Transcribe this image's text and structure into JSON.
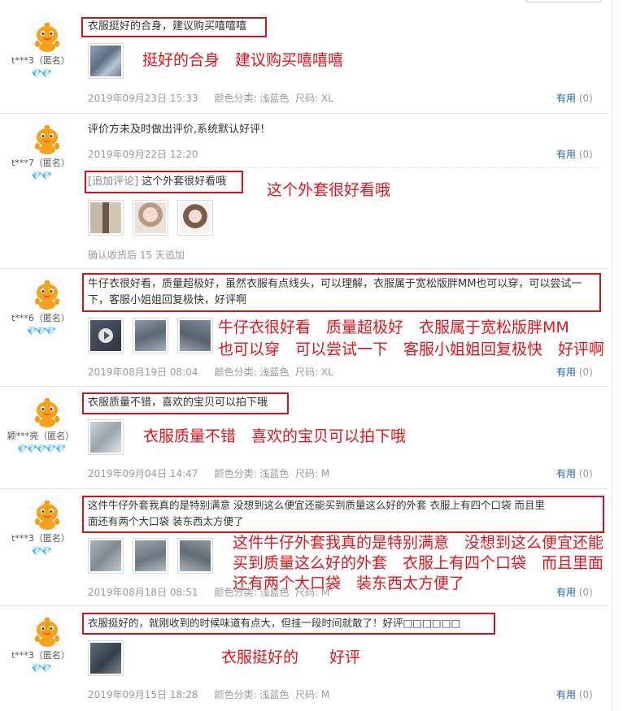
{
  "reviews": [
    {
      "user": "t***3（匿名）",
      "level": "💎💎",
      "text": "衣服挺好的合身，建议购买嘻嘻嘻",
      "annotation": "挺好的合身　建议购买嘻嘻嘻",
      "date": "2019年09月23日 15:33",
      "color_label": "颜色分类:",
      "color": "浅蓝色",
      "size_label": "尺码:",
      "size": "XL",
      "useful_label": "有用",
      "useful_count": "(0)"
    },
    {
      "user": "t***7（匿名）",
      "level": "💎💎",
      "text": "评价方未及时做出评价,系统默认好评!",
      "date": "2019年09月22日 12:20",
      "useful_label": "有用",
      "useful_count": "(0)",
      "append_tag": "[追加评论]",
      "append_text": "这个外套很好看哦",
      "append_annotation": "这个外套很好看哦",
      "append_note": "确认收货后 15 天追加"
    },
    {
      "user": "t***6（匿名）",
      "level": "💎💎💎",
      "text": "牛仔衣很好看，质量超极好，虽然衣服有点线头，可以理解，衣服属于宽松版胖MM也可以穿，可以尝试一下，客服小姐姐回复极快，好评啊",
      "annotation_line1": "牛仔衣很好看　质量超极好　衣服属于宽松版胖MM",
      "annotation_line2": "也可以穿　可以尝试一下　客服小姐姐回复极快　好评啊",
      "date": "2019年08月19日 08:04",
      "color_label": "颜色分类:",
      "color": "浅蓝色",
      "size_label": "尺码:",
      "size": "XL",
      "useful_label": "有用",
      "useful_count": "(0)"
    },
    {
      "user": "颖***亮（匿名）",
      "level": "💎💎💎💎💎",
      "text": "衣服质量不错，喜欢的宝贝可以拍下哦",
      "annotation": "衣服质量不错　喜欢的宝贝可以拍下哦",
      "date": "2019年09月04日 14:47",
      "color_label": "颜色分类:",
      "color": "浅蓝色",
      "size_label": "尺码:",
      "size": "M",
      "useful_label": "有用",
      "useful_count": "(0)"
    },
    {
      "user": "t***3（匿名）",
      "level": "💎💎",
      "text_line1": "这件牛仔外套我真的是特别满意 没想到这么便宜还能买到质量这么好的外套 衣服上有四个口袋 而且里",
      "text_line2": "面还有两个大口袋 装东西太方便了",
      "annotation_line1": "这件牛仔外套我真的是特别满意　没想到这么便宜还能",
      "annotation_line2": "买到质量这么好的外套　衣服上有四个口袋　而且里面",
      "annotation_line3": "还有两个大口袋　装东西太方便了",
      "date": "2019年08月18日 08:51",
      "color_label": "颜色分类:",
      "color": "浅蓝色",
      "size_label": "尺码:",
      "size": "M",
      "useful_label": "有用",
      "useful_count": "(0)"
    },
    {
      "user": "t***3（匿名）",
      "level": "💎💎",
      "text": "衣服挺好的，就刚收到的时候味道有点大，但挂一段时间就散了！好评□□□□□□",
      "annotation": "衣服挺好的　　好评",
      "date": "2019年09月15日 18:28",
      "color_label": "颜色分类:",
      "color": "浅蓝色",
      "size_label": "尺码:",
      "size": "M",
      "useful_label": "有用",
      "useful_count": "(0)"
    }
  ],
  "colors": {
    "annotation_red": "#e4141b",
    "link_blue": "#1f61b3",
    "meta_gray": "#9a9a9a",
    "avatar_orange": "#f39c12"
  },
  "icons": {
    "avatar": "orange-mascot-avatar-icon",
    "level": "red-diamond-level-icon",
    "video": "play-icon"
  }
}
